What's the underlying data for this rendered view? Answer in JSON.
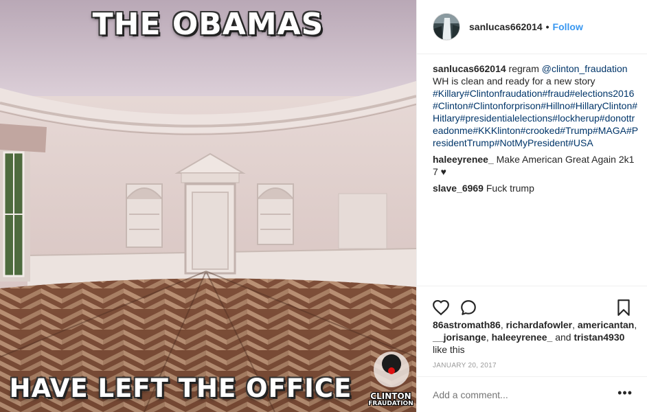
{
  "meme": {
    "top_text": "THE OBAMAS",
    "bottom_text": "HAVE LEFT THE OFFICE",
    "logo_line1": "CLINTON",
    "logo_line2": "FRAUDATION"
  },
  "post_header": {
    "username": "sanlucas662014",
    "separator": "•",
    "follow_label": "Follow"
  },
  "caption": {
    "username": "sanlucas662014",
    "text_prefix": "regram",
    "mention": "@clinton_fraudation",
    "line2": "WH is clean and ready for a new story",
    "hashtags": "#Killary#Clintonfraudation#fraud#elections2016#Clinton#Clintonforprison#Hillno#HillaryClinton#Hitlary#presidentialelections#lockherup#donottreadonme#KKKlinton#crooked#Trump#MAGA#PresidentTrump#NotMyPresident#USA"
  },
  "comments": [
    {
      "username": "haleeyrenee_",
      "text": "Make American Great Again 2k17 ♥"
    },
    {
      "username": "slave_6969",
      "text": "Fuck trump"
    }
  ],
  "actions": {
    "like_icon": "heart-icon",
    "comment_icon": "comment-icon",
    "save_icon": "bookmark-icon"
  },
  "likes": {
    "users": [
      "86astromath86",
      "richardafowler",
      "americantan",
      "__jorisange",
      "haleeyrenee_"
    ],
    "last_user": "tristan4930",
    "sep": ", ",
    "and": " and ",
    "suffix": " like this"
  },
  "timestamp": "JANUARY 20, 2017",
  "add_comment": {
    "placeholder": "Add a comment...",
    "more_label": "•••"
  },
  "colors": {
    "link": "#003569",
    "follow": "#3897f0",
    "muted": "#999999",
    "text": "#262626"
  }
}
